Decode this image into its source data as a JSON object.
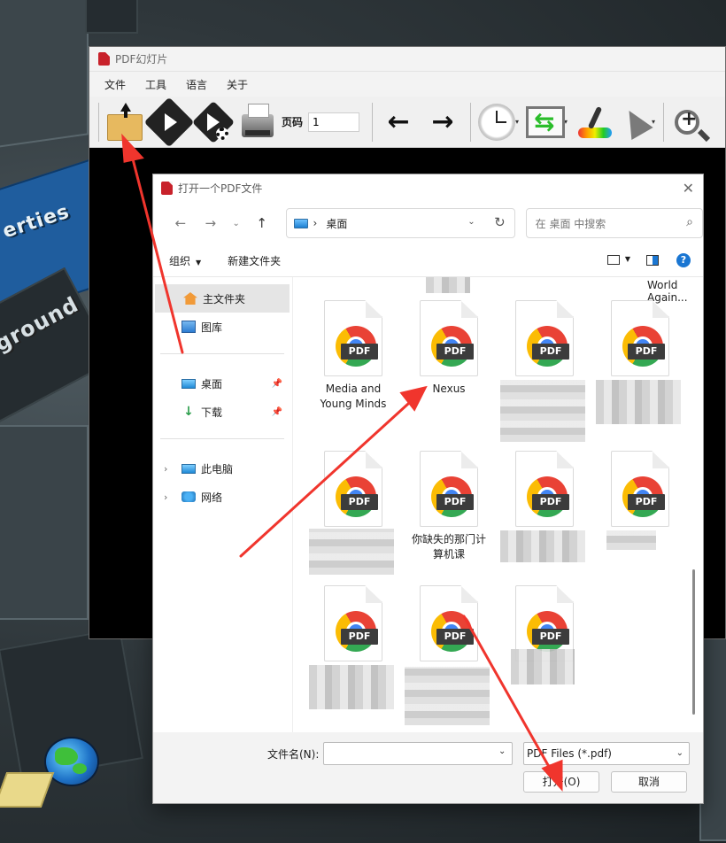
{
  "app": {
    "title": "PDF幻灯片",
    "menu": [
      "文件",
      "工具",
      "语言",
      "关于"
    ],
    "toolbar": {
      "page_label": "页码",
      "page_value": "1"
    }
  },
  "dialog": {
    "title": "打开一个PDF文件",
    "address": {
      "location": "桌面",
      "separator": "›"
    },
    "search_placeholder": "在 桌面 中搜索",
    "commands": {
      "organize": "组织",
      "new_folder": "新建文件夹"
    },
    "sidebar": {
      "items": [
        {
          "label": "主文件夹",
          "icon": "home-icon"
        },
        {
          "label": "图库",
          "icon": "gallery-icon"
        },
        {
          "label": "桌面",
          "icon": "desktop-folder-icon"
        },
        {
          "label": "下载",
          "icon": "download-icon"
        },
        {
          "label": "此电脑",
          "icon": "computer-icon"
        },
        {
          "label": "网络",
          "icon": "network-icon"
        }
      ]
    },
    "files": {
      "top_partial_label": "World Again...",
      "pdf_badge": "PDF",
      "items": [
        {
          "label": "Media and Young Minds"
        },
        {
          "label": "Nexus"
        },
        {
          "label": ""
        },
        {
          "label": ""
        },
        {
          "label": ""
        },
        {
          "label": "你缺失的那门计算机课"
        },
        {
          "label": ""
        },
        {
          "label": ""
        },
        {
          "label": ""
        },
        {
          "label": ""
        },
        {
          "label": ""
        }
      ]
    },
    "footer": {
      "filename_label": "文件名(N):",
      "filename_value": "",
      "filetype": "PDF Files (*.pdf)",
      "open_label": "打开(O)",
      "cancel_label": "取消"
    }
  },
  "background": {
    "word_a": "erties",
    "word_b": "ground"
  },
  "colors": {
    "annotation_red": "#f0352d",
    "accent_blue": "#1a76d2",
    "chrome_red": "#e94235",
    "chrome_green": "#34a853",
    "chrome_yellow": "#fbbc04"
  }
}
